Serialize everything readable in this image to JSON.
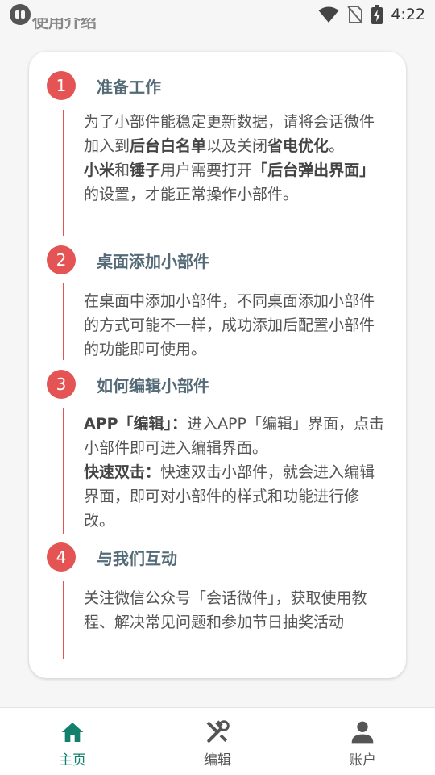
{
  "status_bar": {
    "time": "4:22"
  },
  "header_peek": "使用介绍",
  "steps": [
    {
      "num": "1",
      "title": "准备工作",
      "body_parts": [
        {
          "t": " 为了小部件能稳定更新数据，请将会话微件加入到",
          "b": false
        },
        {
          "t": "后台白名单",
          "b": true
        },
        {
          "t": "以及关闭",
          "b": false
        },
        {
          "t": "省电优化",
          "b": true
        },
        {
          "t": "。",
          "b": false
        },
        {
          "t": "\n",
          "b": false
        },
        {
          "t": " 小米",
          "b": true
        },
        {
          "t": "和",
          "b": false
        },
        {
          "t": "锤子",
          "b": true
        },
        {
          "t": "用户需要打开",
          "b": false
        },
        {
          "t": "「后台弹出界面」",
          "b": true
        },
        {
          "t": "的设置，才能正常操作小部件。",
          "b": false
        }
      ]
    },
    {
      "num": "2",
      "title": "桌面添加小部件",
      "body_parts": [
        {
          "t": "在桌面中添加小部件，不同桌面添加小部件的方式可能不一样，成功添加后配置小部件的功能即可使用。",
          "b": false
        }
      ]
    },
    {
      "num": "3",
      "title": "如何编辑小部件",
      "body_parts": [
        {
          "t": "APP「编辑」：",
          "b": true
        },
        {
          "t": "进入APP「编辑」界面，点击小部件即可进入编辑界面。",
          "b": false
        },
        {
          "t": "\n",
          "b": false
        },
        {
          "t": "快速双击：",
          "b": true
        },
        {
          "t": "快速双击小部件，就会进入编辑界面，即可对小部件的样式和功能进行修改。",
          "b": false
        }
      ]
    },
    {
      "num": "4",
      "title": "与我们互动",
      "body_parts": [
        {
          "t": "关注微信公众号「会话微件」，获取使用教程、解决常见问题和参加节日抽奖活动",
          "b": false
        }
      ]
    }
  ],
  "nav": [
    {
      "label": "主页",
      "icon": "home-icon",
      "active": true
    },
    {
      "label": "编辑",
      "icon": "tools-icon",
      "active": false
    },
    {
      "label": "账户",
      "icon": "person-icon",
      "active": false
    }
  ],
  "colors": {
    "accent": "#e45454",
    "title": "#546a76",
    "nav_active": "#13806d"
  }
}
